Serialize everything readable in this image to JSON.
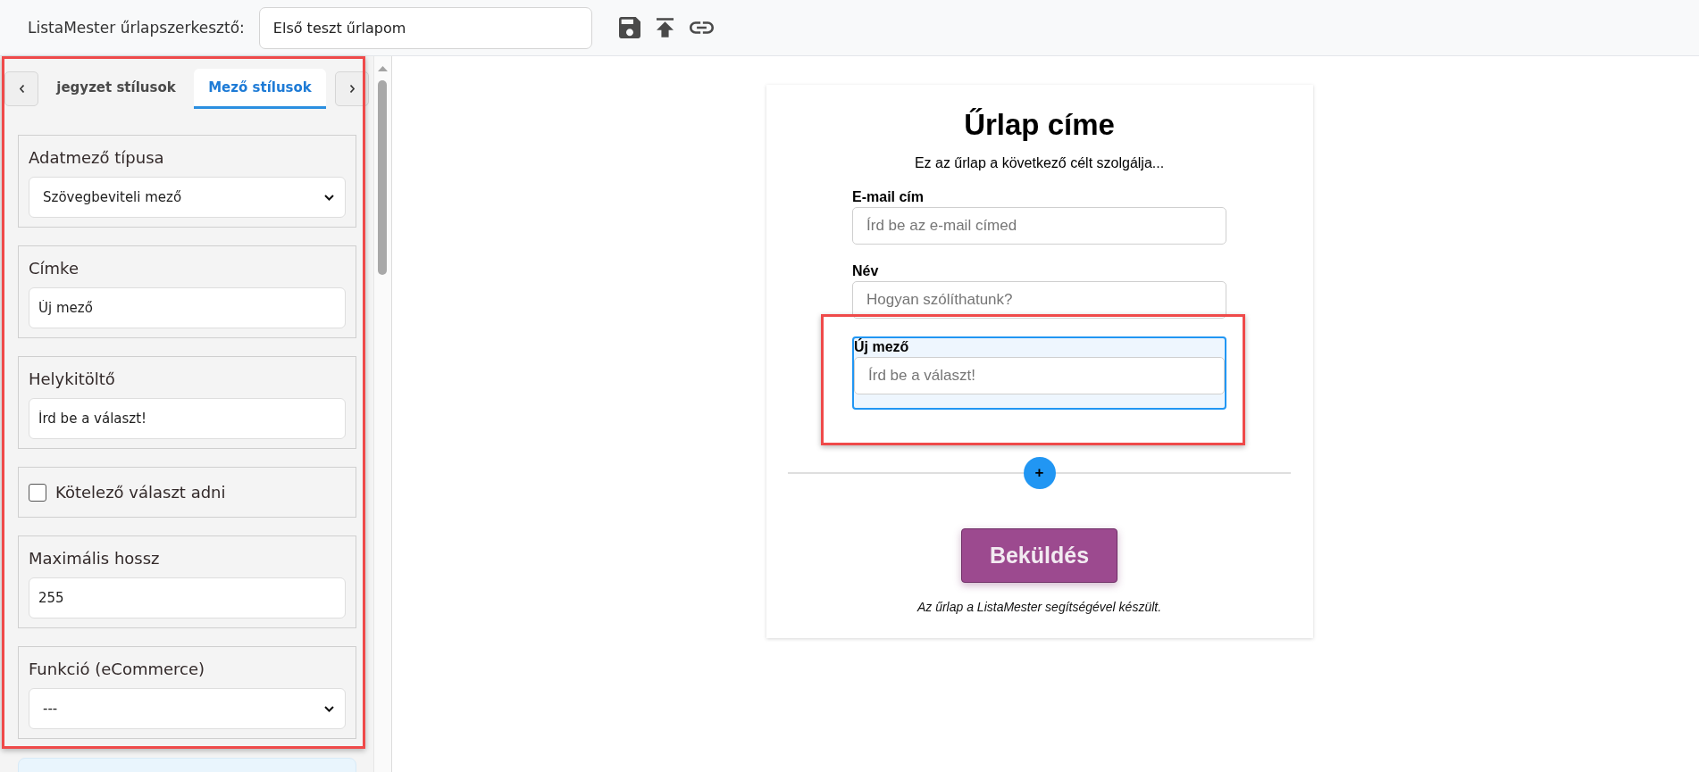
{
  "header": {
    "title": "ListaMester űrlapszerkesztő:",
    "form_name": "Első teszt űrlapom"
  },
  "sidebar": {
    "highlighted": true,
    "tabs": [
      {
        "label": "jegyzet stílusok",
        "selected": false
      },
      {
        "label": "Mező stílusok",
        "selected": true
      }
    ],
    "sections": [
      {
        "kind": "select",
        "label": "Adatmező típusa",
        "value": "Szövegbeviteli mező"
      },
      {
        "kind": "input",
        "label": "Címke",
        "value": "Új mező"
      },
      {
        "kind": "input",
        "label": "Helykitöltő",
        "value": "Írd be a választ!"
      },
      {
        "kind": "checkbox",
        "label": "Kötelező választ adni",
        "checked": false
      },
      {
        "kind": "input",
        "label": "Maximális hossz",
        "value": "255"
      },
      {
        "kind": "select",
        "label": "Funkció (eCommerce)",
        "value": "---"
      }
    ]
  },
  "form": {
    "title": "Űrlap címe",
    "description": "Ez az űrlap a következő célt szolgálja...",
    "fields": [
      {
        "label": "E-mail cím",
        "placeholder": "Írd be az e-mail címed",
        "selected": false,
        "highlighted": false
      },
      {
        "label": "Név",
        "placeholder": "Hogyan szólíthatunk?",
        "selected": false,
        "highlighted": false
      },
      {
        "label": "Új mező",
        "placeholder": "Írd be a választ!",
        "selected": true,
        "highlighted": true
      }
    ],
    "add_button": "+",
    "submit": "Beküldés",
    "footer": "Az űrlap a ListaMester segítségével készült."
  }
}
